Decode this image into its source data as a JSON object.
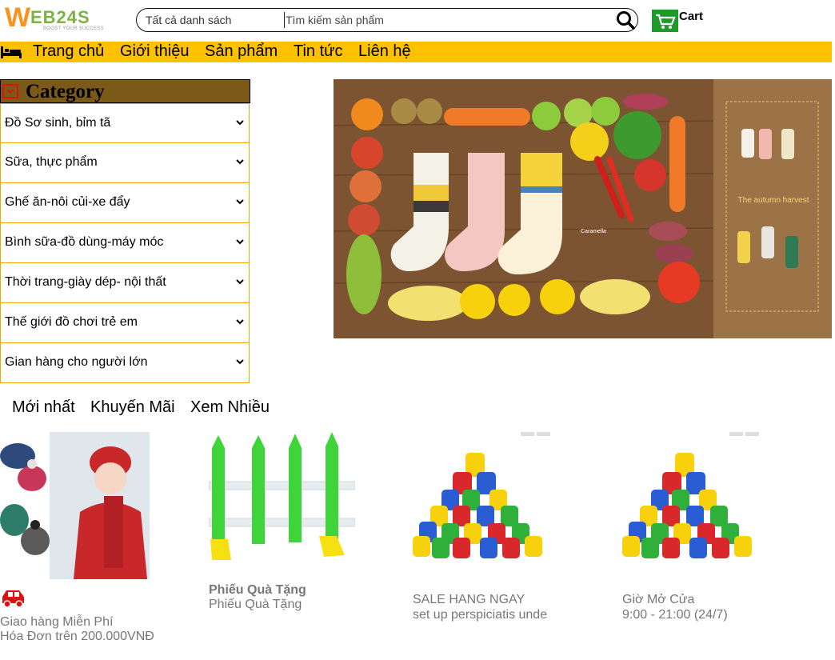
{
  "header": {
    "logo_text_w": "W",
    "logo_text_rest": "EB24S",
    "logo_tagline": "BOOST YOUR SUCCESS",
    "search_category": "Tất cả danh sách",
    "search_placeholder": "Tìm kiếm sản phẩm",
    "cart_label": "Cart"
  },
  "nav": {
    "items": [
      "Trang chủ",
      "Giới thiệu",
      "Sản phẩm",
      "Tin tức",
      "Liên hệ"
    ]
  },
  "category": {
    "title": "Category",
    "items": [
      "Đồ Sơ sinh, bỉm tã",
      "Sữa, thực phẩm",
      "Ghế ăn-nôi củi-xe đẩy",
      "Bình sữa-đồ dùng-máy móc",
      "Thời trang-giày dép- nội thất",
      "Thế giới đồ chơi trẻ em",
      "Gian hàng cho người lớn"
    ]
  },
  "banner": {
    "caption": "The autumn harvest",
    "brand": "Caramella"
  },
  "tabs": [
    "Mới nhất",
    "Khuyến Mãi",
    "Xem Nhiều"
  ],
  "features": [
    {
      "line1": "Giao hàng Miễn Phí",
      "line2": "Hóa Đơn trên 200.000VNĐ",
      "icon": "car-icon"
    },
    {
      "line1": "Phiếu Quà Tặng",
      "line2": "Phiếu Quà Tặng"
    },
    {
      "line1": "SALE HANG NGAY",
      "line2": "set up perspiciatis unde"
    },
    {
      "line1": "Giờ Mở Cửa",
      "line2": "9:00 - 21:00 (24/7)"
    }
  ],
  "colors": {
    "nav_bg": "#fdc100",
    "category_header_bg": "#7a5a16",
    "category_border": "#f0a800",
    "cart_green": "#1c9b2b",
    "accent_red": "#e01010",
    "logo_orange": "#f7931e",
    "logo_green": "#7cb342"
  }
}
